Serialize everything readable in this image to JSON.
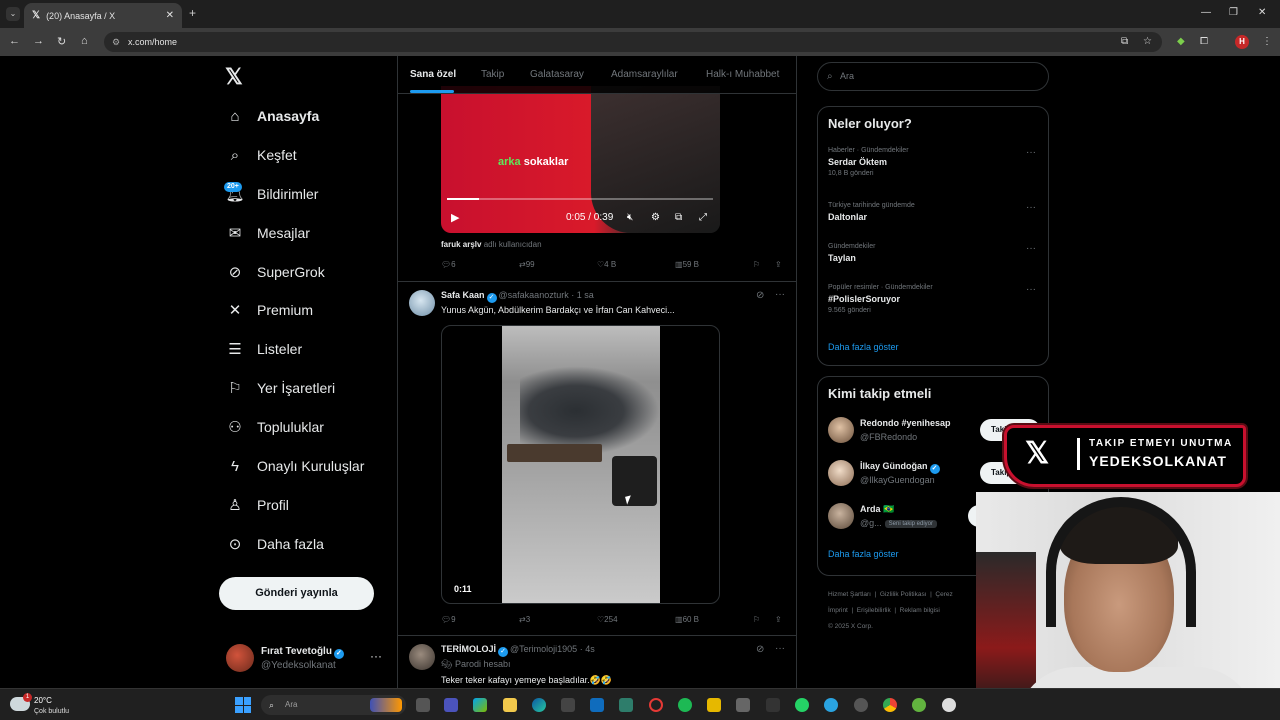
{
  "browser": {
    "tab_title": "(20) Anasayfa / X",
    "url": "x.com/home",
    "profile_initial": "H"
  },
  "left_nav": {
    "items": [
      {
        "label": "Anasayfa",
        "icon": "home-icon"
      },
      {
        "label": "Keşfet",
        "icon": "search-icon"
      },
      {
        "label": "Bildirimler",
        "icon": "bell-icon",
        "badge": "20+"
      },
      {
        "label": "Mesajlar",
        "icon": "mail-icon"
      },
      {
        "label": "SuperGrok",
        "icon": "grok-icon"
      },
      {
        "label": "Premium",
        "icon": "x-icon"
      },
      {
        "label": "Listeler",
        "icon": "list-icon"
      },
      {
        "label": "Yer İşaretleri",
        "icon": "bookmark-icon"
      },
      {
        "label": "Topluluklar",
        "icon": "people-icon"
      },
      {
        "label": "Onaylı Kuruluşlar",
        "icon": "lightning-icon"
      },
      {
        "label": "Profil",
        "icon": "person-icon"
      },
      {
        "label": "Daha fazla",
        "icon": "more-circle-icon"
      }
    ],
    "post_button": "Gönderi yayınla",
    "account": {
      "name": "Fırat Tevetoğlu",
      "handle": "@Yedeksolkanat",
      "more": "···"
    }
  },
  "timeline": {
    "tabs": [
      "Sana özel",
      "Takip",
      "Galatasaray",
      "Adamsaraylılar",
      "Halk-ı Muhabbet"
    ],
    "post1": {
      "video_caption_green": "arka",
      "video_caption_white": "sokaklar",
      "video_time": "0:05 / 0:39",
      "attribution_user": "faruk arşlv",
      "attribution_rest": "adlı kullanıcıdan",
      "replies": "6",
      "reposts": "99",
      "likes": "4 B",
      "views": "59 B"
    },
    "post2": {
      "name": "Safa Kaan",
      "handle": "@safakaanozturk",
      "time": "· 1 sa",
      "text": "Yunus Akgün, Abdülkerim Bardakçı ve İrfan Can Kahveci...",
      "video_duration": "0:11",
      "replies": "9",
      "reposts": "3",
      "likes": "254",
      "views": "60 B"
    },
    "post3": {
      "name": "TERİMOLOJİ",
      "handle": "@Terimoloji1905",
      "time": "· 4s",
      "parody": "Parodi hesabı",
      "text": "Teker teker kafayı yemeye başladılar.🤣🤣"
    }
  },
  "right": {
    "search_placeholder": "Ara",
    "trends_title": "Neler oluyor?",
    "trends": [
      {
        "category": "Haberler · Gündemdekiler",
        "title": "Serdar Öktem",
        "count": "10,8 B gönderi"
      },
      {
        "category": "Türkiye tarihinde gündemde",
        "title": "Daltonlar",
        "count": ""
      },
      {
        "category": "Gündemdekiler",
        "title": "Taylan",
        "count": ""
      },
      {
        "category": "Popüler resimler · Gündemdekiler",
        "title": "#PolislerSoruyor",
        "count": "9.565 gönderi"
      }
    ],
    "trends_more": "Daha fazla göster",
    "wtf_title": "Kimi takip etmeli",
    "wtf": [
      {
        "name": "Redondo #yenihesap",
        "handle": "@FBRedondo",
        "button": "Takip"
      },
      {
        "name": "İlkay Gündoğan",
        "handle": "@IlkayGuendogan",
        "button": "Takip"
      },
      {
        "name": "Arda 🇧🇷",
        "handle": "@g...",
        "tag": "Seni takip ediyor",
        "button": "G"
      }
    ],
    "wtf_more": "Daha fazla göster",
    "footer": [
      "Hizmet Şartları",
      "Gizlilik Politikası",
      "Çerez",
      "İmprint",
      "Erişilebilirlik",
      "Reklam bilgisi",
      "© 2025 X Corp."
    ]
  },
  "overlay": {
    "line1": "TAKIP ETMEYI UNUTMA",
    "line2": "YEDEKSOLKANAT"
  },
  "taskbar": {
    "temp": "20°C",
    "weather": "Çok bulutlu",
    "weather_badge": "1",
    "search_placeholder": "Ara"
  }
}
